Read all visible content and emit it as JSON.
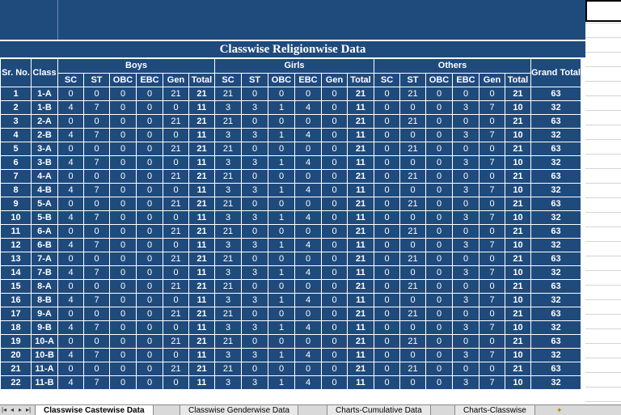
{
  "sheet": {
    "title": "Classwise Religionwise Data",
    "headers": {
      "srno": "Sr. No.",
      "class": "Class",
      "boys": "Boys",
      "girls": "Girls",
      "others": "Others",
      "grand_total": "Grand Total",
      "sub": [
        "SC",
        "ST",
        "OBC",
        "EBC",
        "Gen",
        "Total"
      ]
    },
    "rows": [
      [
        "1",
        "1-A",
        "0",
        "0",
        "0",
        "0",
        "21",
        "21",
        "21",
        "0",
        "0",
        "0",
        "0",
        "21",
        "0",
        "21",
        "0",
        "0",
        "0",
        "21",
        "63"
      ],
      [
        "2",
        "1-B",
        "4",
        "7",
        "0",
        "0",
        "0",
        "11",
        "3",
        "3",
        "1",
        "4",
        "0",
        "11",
        "0",
        "0",
        "0",
        "3",
        "7",
        "10",
        "32"
      ],
      [
        "3",
        "2-A",
        "0",
        "0",
        "0",
        "0",
        "21",
        "21",
        "21",
        "0",
        "0",
        "0",
        "0",
        "21",
        "0",
        "21",
        "0",
        "0",
        "0",
        "21",
        "63"
      ],
      [
        "4",
        "2-B",
        "4",
        "7",
        "0",
        "0",
        "0",
        "11",
        "3",
        "3",
        "1",
        "4",
        "0",
        "11",
        "0",
        "0",
        "0",
        "3",
        "7",
        "10",
        "32"
      ],
      [
        "5",
        "3-A",
        "0",
        "0",
        "0",
        "0",
        "21",
        "21",
        "21",
        "0",
        "0",
        "0",
        "0",
        "21",
        "0",
        "21",
        "0",
        "0",
        "0",
        "21",
        "63"
      ],
      [
        "6",
        "3-B",
        "4",
        "7",
        "0",
        "0",
        "0",
        "11",
        "3",
        "3",
        "1",
        "4",
        "0",
        "11",
        "0",
        "0",
        "0",
        "3",
        "7",
        "10",
        "32"
      ],
      [
        "7",
        "4-A",
        "0",
        "0",
        "0",
        "0",
        "21",
        "21",
        "21",
        "0",
        "0",
        "0",
        "0",
        "21",
        "0",
        "21",
        "0",
        "0",
        "0",
        "21",
        "63"
      ],
      [
        "8",
        "4-B",
        "4",
        "7",
        "0",
        "0",
        "0",
        "11",
        "3",
        "3",
        "1",
        "4",
        "0",
        "11",
        "0",
        "0",
        "0",
        "3",
        "7",
        "10",
        "32"
      ],
      [
        "9",
        "5-A",
        "0",
        "0",
        "0",
        "0",
        "21",
        "21",
        "21",
        "0",
        "0",
        "0",
        "0",
        "21",
        "0",
        "21",
        "0",
        "0",
        "0",
        "21",
        "63"
      ],
      [
        "10",
        "5-B",
        "4",
        "7",
        "0",
        "0",
        "0",
        "11",
        "3",
        "3",
        "1",
        "4",
        "0",
        "11",
        "0",
        "0",
        "0",
        "3",
        "7",
        "10",
        "32"
      ],
      [
        "11",
        "6-A",
        "0",
        "0",
        "0",
        "0",
        "21",
        "21",
        "21",
        "0",
        "0",
        "0",
        "0",
        "21",
        "0",
        "21",
        "0",
        "0",
        "0",
        "21",
        "63"
      ],
      [
        "12",
        "6-B",
        "4",
        "7",
        "0",
        "0",
        "0",
        "11",
        "3",
        "3",
        "1",
        "4",
        "0",
        "11",
        "0",
        "0",
        "0",
        "3",
        "7",
        "10",
        "32"
      ],
      [
        "13",
        "7-A",
        "0",
        "0",
        "0",
        "0",
        "21",
        "21",
        "21",
        "0",
        "0",
        "0",
        "0",
        "21",
        "0",
        "21",
        "0",
        "0",
        "0",
        "21",
        "63"
      ],
      [
        "14",
        "7-B",
        "4",
        "7",
        "0",
        "0",
        "0",
        "11",
        "3",
        "3",
        "1",
        "4",
        "0",
        "11",
        "0",
        "0",
        "0",
        "3",
        "7",
        "10",
        "32"
      ],
      [
        "15",
        "8-A",
        "0",
        "0",
        "0",
        "0",
        "21",
        "21",
        "21",
        "0",
        "0",
        "0",
        "0",
        "21",
        "0",
        "21",
        "0",
        "0",
        "0",
        "21",
        "63"
      ],
      [
        "16",
        "8-B",
        "4",
        "7",
        "0",
        "0",
        "0",
        "11",
        "3",
        "3",
        "1",
        "4",
        "0",
        "11",
        "0",
        "0",
        "0",
        "3",
        "7",
        "10",
        "32"
      ],
      [
        "17",
        "9-A",
        "0",
        "0",
        "0",
        "0",
        "21",
        "21",
        "21",
        "0",
        "0",
        "0",
        "0",
        "21",
        "0",
        "21",
        "0",
        "0",
        "0",
        "21",
        "63"
      ],
      [
        "18",
        "9-B",
        "4",
        "7",
        "0",
        "0",
        "0",
        "11",
        "3",
        "3",
        "1",
        "4",
        "0",
        "11",
        "0",
        "0",
        "0",
        "3",
        "7",
        "10",
        "32"
      ],
      [
        "19",
        "10-A",
        "0",
        "0",
        "0",
        "0",
        "21",
        "21",
        "21",
        "0",
        "0",
        "0",
        "0",
        "21",
        "0",
        "21",
        "0",
        "0",
        "0",
        "21",
        "63"
      ],
      [
        "20",
        "10-B",
        "4",
        "7",
        "0",
        "0",
        "0",
        "11",
        "3",
        "3",
        "1",
        "4",
        "0",
        "11",
        "0",
        "0",
        "0",
        "3",
        "7",
        "10",
        "32"
      ],
      [
        "21",
        "11-A",
        "0",
        "0",
        "0",
        "0",
        "21",
        "21",
        "21",
        "0",
        "0",
        "0",
        "0",
        "21",
        "0",
        "21",
        "0",
        "0",
        "0",
        "21",
        "63"
      ],
      [
        "22",
        "11-B",
        "4",
        "7",
        "0",
        "0",
        "0",
        "11",
        "3",
        "3",
        "1",
        "4",
        "0",
        "11",
        "0",
        "0",
        "0",
        "3",
        "7",
        "10",
        "32"
      ]
    ]
  },
  "tabs": [
    "Classwise Castewise Data",
    "Classwise Genderwise Data",
    "Charts-Cumulative Data",
    "Charts-Classwise"
  ],
  "active_tab": 0,
  "colors": {
    "header_bg": "#1f4a7c",
    "text": "#ffffff"
  },
  "icons": [
    "nav-first-icon",
    "nav-prev-icon",
    "nav-next-icon",
    "nav-last-icon",
    "insert-sheet-icon"
  ]
}
